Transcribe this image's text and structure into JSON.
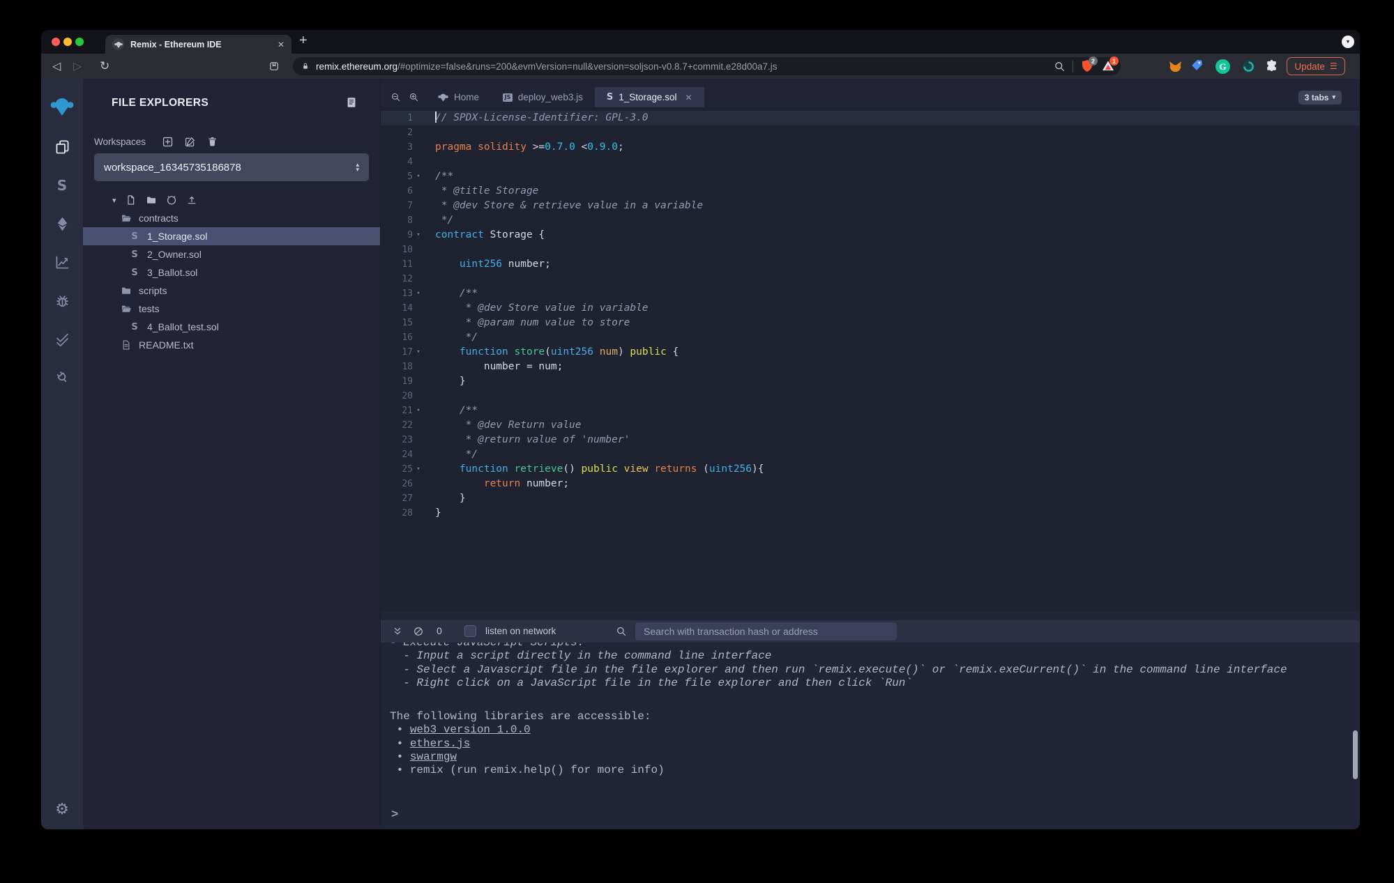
{
  "browser": {
    "tab_title": "Remix - Ethereum IDE",
    "url_domain": "remix.ethereum.org",
    "url_path": "/#optimize=false&runs=200&evmVersion=null&version=soljson-v0.8.7+commit.e28d00a7.js",
    "shield_badge": "2",
    "rewards_badge": "1",
    "update_label": "Update",
    "extension_icons": [
      "metamask-fox",
      "blue-tag",
      "grammarly",
      "teal-swirl",
      "puzzle-extensions"
    ]
  },
  "glyphs": {
    "close": "✕",
    "plus": "+",
    "chevron_down": "▼",
    "back": "◁",
    "forward": "▷",
    "reload": "↻",
    "burger": "☰",
    "gear": "⚙",
    "caret_down": "▾",
    "caret_up": "▴",
    "bullet": "•",
    "solidity": "S",
    "js": "JS",
    "grammarly_g": "G"
  },
  "rail": {
    "icons": [
      "file-explorer",
      "solidity-compiler",
      "deploy-and-run",
      "analysis",
      "debugger",
      "unit-testing",
      "plugin-manager"
    ],
    "active": "file-explorer"
  },
  "explorer": {
    "title": "FILE EXPLORERS",
    "workspaces_label": "Workspaces",
    "workspace_name": "workspace_16345735186878",
    "tree": [
      {
        "icon": "folder-open",
        "label": "contracts",
        "indent": 0
      },
      {
        "icon": "solidity",
        "label": "1_Storage.sol",
        "indent": 1,
        "selected": true
      },
      {
        "icon": "solidity",
        "label": "2_Owner.sol",
        "indent": 1
      },
      {
        "icon": "solidity",
        "label": "3_Ballot.sol",
        "indent": 1
      },
      {
        "icon": "folder",
        "label": "scripts",
        "indent": 0
      },
      {
        "icon": "folder-open",
        "label": "tests",
        "indent": 0
      },
      {
        "icon": "solidity",
        "label": "4_Ballot_test.sol",
        "indent": 1
      },
      {
        "icon": "file",
        "label": "README.txt",
        "indent": 0
      }
    ]
  },
  "editor": {
    "tabs": [
      {
        "icon": "remix",
        "label": "Home"
      },
      {
        "icon": "js",
        "label": "deploy_web3.js"
      },
      {
        "icon": "solidity",
        "label": "1_Storage.sol",
        "active": true
      }
    ],
    "tabs_badge": "3 tabs",
    "code": {
      "language": "solidity",
      "lines": [
        {
          "n": 1,
          "h": true,
          "cursor": true,
          "t": [
            [
              "cm",
              "// SPDX-License-Identifier: GPL-3.0"
            ]
          ]
        },
        {
          "n": 2,
          "t": []
        },
        {
          "n": 3,
          "t": [
            [
              "o",
              "pragma solidity "
            ],
            [
              "w",
              ">="
            ],
            [
              "n",
              "0.7.0"
            ],
            [
              "w",
              " <"
            ],
            [
              "n",
              "0.9.0"
            ],
            [
              "w",
              ";"
            ]
          ]
        },
        {
          "n": 4,
          "t": []
        },
        {
          "n": 5,
          "f": 1,
          "t": [
            [
              "cm",
              "/**"
            ]
          ]
        },
        {
          "n": 6,
          "t": [
            [
              "cm",
              " * @title Storage"
            ]
          ]
        },
        {
          "n": 7,
          "t": [
            [
              "cm",
              " * @dev Store & retrieve value in a variable"
            ]
          ]
        },
        {
          "n": 8,
          "t": [
            [
              "cm",
              " */"
            ]
          ]
        },
        {
          "n": 9,
          "f": 1,
          "t": [
            [
              "b",
              "contract"
            ],
            [
              "w",
              " Storage {"
            ]
          ]
        },
        {
          "n": 10,
          "t": []
        },
        {
          "n": 11,
          "t": [
            [
              "w",
              "    "
            ],
            [
              "b",
              "uint256"
            ],
            [
              "w",
              " number;"
            ]
          ]
        },
        {
          "n": 12,
          "t": []
        },
        {
          "n": 13,
          "f": 1,
          "t": [
            [
              "cm",
              "    /**"
            ]
          ]
        },
        {
          "n": 14,
          "t": [
            [
              "cm",
              "     * @dev Store value in variable"
            ]
          ]
        },
        {
          "n": 15,
          "t": [
            [
              "cm",
              "     * @param num value to store"
            ]
          ]
        },
        {
          "n": 16,
          "t": [
            [
              "cm",
              "     */"
            ]
          ]
        },
        {
          "n": 17,
          "f": 1,
          "t": [
            [
              "w",
              "    "
            ],
            [
              "b",
              "function"
            ],
            [
              "w",
              " "
            ],
            [
              "g",
              "store"
            ],
            [
              "w",
              "("
            ],
            [
              "b",
              "uint256"
            ],
            [
              "w",
              " "
            ],
            [
              "p",
              "num"
            ],
            [
              "w",
              ") "
            ],
            [
              "y",
              "public"
            ],
            [
              "w",
              " {"
            ]
          ]
        },
        {
          "n": 18,
          "t": [
            [
              "w",
              "        number = num;"
            ]
          ]
        },
        {
          "n": 19,
          "t": [
            [
              "w",
              "    }"
            ]
          ]
        },
        {
          "n": 20,
          "t": []
        },
        {
          "n": 21,
          "f": 1,
          "t": [
            [
              "cm",
              "    /**"
            ]
          ]
        },
        {
          "n": 22,
          "t": [
            [
              "cm",
              "     * @dev Return value"
            ]
          ]
        },
        {
          "n": 23,
          "t": [
            [
              "cm",
              "     * @return value of 'number'"
            ]
          ]
        },
        {
          "n": 24,
          "t": [
            [
              "cm",
              "     */"
            ]
          ]
        },
        {
          "n": 25,
          "f": 1,
          "t": [
            [
              "w",
              "    "
            ],
            [
              "b",
              "function"
            ],
            [
              "w",
              " "
            ],
            [
              "g",
              "retrieve"
            ],
            [
              "w",
              "() "
            ],
            [
              "y",
              "public"
            ],
            [
              "w",
              " "
            ],
            [
              "v",
              "view"
            ],
            [
              "w",
              " "
            ],
            [
              "o",
              "returns"
            ],
            [
              "w",
              " ("
            ],
            [
              "b",
              "uint256"
            ],
            [
              "w",
              "){"
            ]
          ]
        },
        {
          "n": 26,
          "t": [
            [
              "w",
              "        "
            ],
            [
              "o",
              "return"
            ],
            [
              "w",
              " number;"
            ]
          ]
        },
        {
          "n": 27,
          "t": [
            [
              "w",
              "    }"
            ]
          ]
        },
        {
          "n": 28,
          "t": [
            [
              "w",
              "}"
            ]
          ]
        }
      ]
    }
  },
  "terminal": {
    "count": "0",
    "listen_label": "listen on network",
    "search_placeholder": "Search with transaction hash or address",
    "lines": [
      {
        "italic": true,
        "clipped": true,
        "text": "- Execute JavaScript Scripts:"
      },
      {
        "italic": true,
        "text": "  - Input a script directly in the command line interface"
      },
      {
        "italic": true,
        "text": "  - Select a Javascript file in the file explorer and then run `remix.execute()` or `remix.exeCurrent()` in the command line interface"
      },
      {
        "italic": true,
        "text": "  - Right click on a JavaScript file in the file explorer and then click `Run`"
      },
      {
        "gap": true,
        "text": "The following libraries are accessible:"
      },
      {
        "bullet": true,
        "link": true,
        "text": "web3 version 1.0.0"
      },
      {
        "bullet": true,
        "link": true,
        "text": "ethers.js"
      },
      {
        "bullet": true,
        "link": true,
        "text": "swarmgw"
      },
      {
        "bullet": true,
        "text": "remix (run remix.help() for more info)"
      }
    ],
    "prompt": ">"
  },
  "colors": {
    "accent_blue": "#2f99cf",
    "update_orange": "#ee6d55",
    "shield_orange": "#fb542b",
    "selected_row": "#4a5070",
    "editor_bg": "#1e2231",
    "panel_bg": "#222336",
    "terminal_bg": "#222437",
    "syntax": {
      "comment": "#969ab3",
      "keyword": "#41b0e6",
      "number": "#2ec3e8",
      "function_name": "#41c98f",
      "param": "#deb06a",
      "public": "#d9e04f",
      "view": "#eec64f",
      "orange": "#e8824a",
      "plain": "#d6d9e8"
    }
  }
}
